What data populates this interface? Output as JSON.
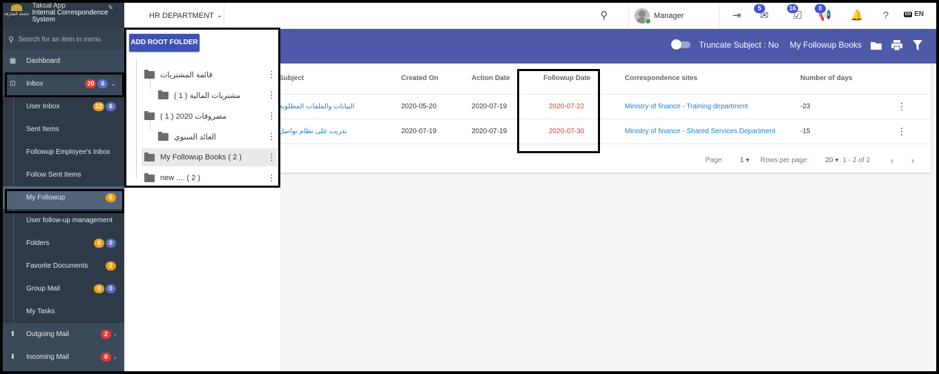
{
  "sidebar": {
    "app_name": "Taksal App",
    "system_name": "Internal Correspondence System",
    "logo_text": "جامعة الشارقة",
    "search_placeholder": "Search for an item in menu",
    "items": [
      {
        "label": "Dashboard",
        "icon": "dashboard-icon"
      },
      {
        "label": "Inbox",
        "badges": [
          "20",
          "6"
        ],
        "icon": "inbox-icon"
      },
      {
        "label": "User Inbox",
        "badges": [
          "12",
          "6"
        ]
      },
      {
        "label": "Sent Items"
      },
      {
        "label": "Followup Employee's Inbox"
      },
      {
        "label": "Follow Sent Items"
      },
      {
        "label": "My Followup",
        "badges": [
          "6"
        ]
      },
      {
        "label": "User follow-up management"
      },
      {
        "label": "Folders",
        "badges": [
          "0",
          "0"
        ]
      },
      {
        "label": "Favorite Documents",
        "badges": [
          "2"
        ]
      },
      {
        "label": "Group Mail",
        "badges": [
          "0",
          "0"
        ]
      },
      {
        "label": "My Tasks"
      },
      {
        "label": "Outgoing Mail",
        "badges": [
          "2"
        ],
        "icon": "outgoing-mail-icon"
      },
      {
        "label": "Incoming Mail",
        "badges": [
          "0"
        ],
        "icon": "incoming-mail-icon"
      }
    ]
  },
  "topbar": {
    "department": "HR DEPARTMENT",
    "user_name": "Manager",
    "badge_mail": "5",
    "badge_tasks": "16",
    "badge_announce": "0",
    "language": "EN",
    "lang_flag": "EN"
  },
  "toolbar": {
    "truncate_label": "Truncate Subject : No",
    "books_label": "My Followup Books"
  },
  "folders": {
    "add_root_label": "ADD ROOT FOLDER",
    "items": [
      {
        "label": "قائمة المشتريات",
        "count": ""
      },
      {
        "label": "مشتريات المالية",
        "count": "( 1 )"
      },
      {
        "label": "مصروفات 2020",
        "count": "( 1 )"
      },
      {
        "label": "العائد السنوي",
        "count": ""
      },
      {
        "label": "My Followup Books",
        "count": "( 2 )"
      },
      {
        "label": "new ....",
        "count": "( 2 )"
      }
    ]
  },
  "table": {
    "columns": [
      "Subject",
      "Created On",
      "Action Date",
      "Followup Date",
      "Correspondence sites",
      "Number of days"
    ],
    "rows": [
      {
        "subject": "البيانات والملفات المطلوبة",
        "created_on": "2020-05-20",
        "action_date": "2020-07-19",
        "followup_date": "2020-07-22",
        "sites": "Ministry of finance - Training department",
        "days": "-23"
      },
      {
        "subject": "تدريب على نظام تواصل",
        "created_on": "2020-07-19",
        "action_date": "2020-07-19",
        "followup_date": "2020-07-30",
        "sites": "Ministry of finance - Shared Services Department",
        "days": "-15"
      }
    ]
  },
  "pager": {
    "page_label": "Page:",
    "page_value": "1",
    "rows_label": "Rows per page:",
    "rows_value": "20",
    "range": "1 - 2 of 2"
  },
  "colors": {
    "sidebar_bg": "#3b4a5a",
    "banner": "#4c5aa7",
    "primary_button": "#3f51b5",
    "followup_date": "#e53935",
    "link": "#1e7fc6"
  }
}
